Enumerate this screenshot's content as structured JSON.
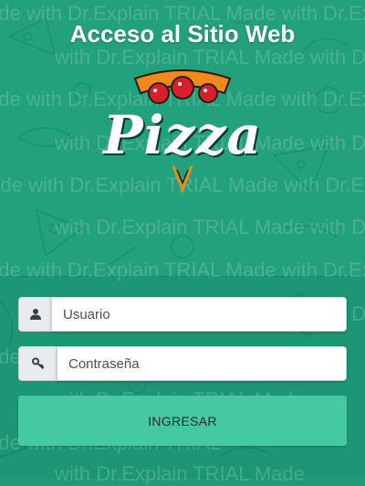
{
  "page": {
    "title": "Acceso al Sitio Web"
  },
  "logo": {
    "word": "Pizza",
    "icon": "pizza-logo-icon"
  },
  "form": {
    "username": {
      "placeholder": "Usuario",
      "icon": "user-icon"
    },
    "password": {
      "placeholder": "Contraseña",
      "icon": "key-icon"
    },
    "submit_label": "INGRESAR"
  },
  "watermark": {
    "lines": [
      "ade with Dr.Explain TRIAL  Made with Dr.Explain TRIAL",
      "with Dr.Explain TRIAL  Made with Dr.Explain TRIAL",
      "ade with Dr.Explain TRIAL  Made with Dr.Explain TRIAL",
      "with Dr.Explain TRIAL  Made with Dr.Explain TRIAL",
      "Made with Dr.Explain TRIAL  Made with Dr.Explain",
      "with Dr.Explain TRIAL  Made with Dr.Explain TRIAL",
      "ade with Dr.Explain TRIAL  Made with Dr.Explain TRIAL",
      "with Dr.Explain TRIAL  Made with Dr.Explain TRIAL",
      "with Dr.Explain TRIAL  Made",
      "ade with Dr.Explain TRIAL  Made",
      "with Dr.Explain TRIAL  Made",
      "ade with Dr.Explain TRIAL"
    ]
  },
  "colors": {
    "background": "#23a07c",
    "button": "#45c9a0",
    "title_text": "#ffffff"
  }
}
